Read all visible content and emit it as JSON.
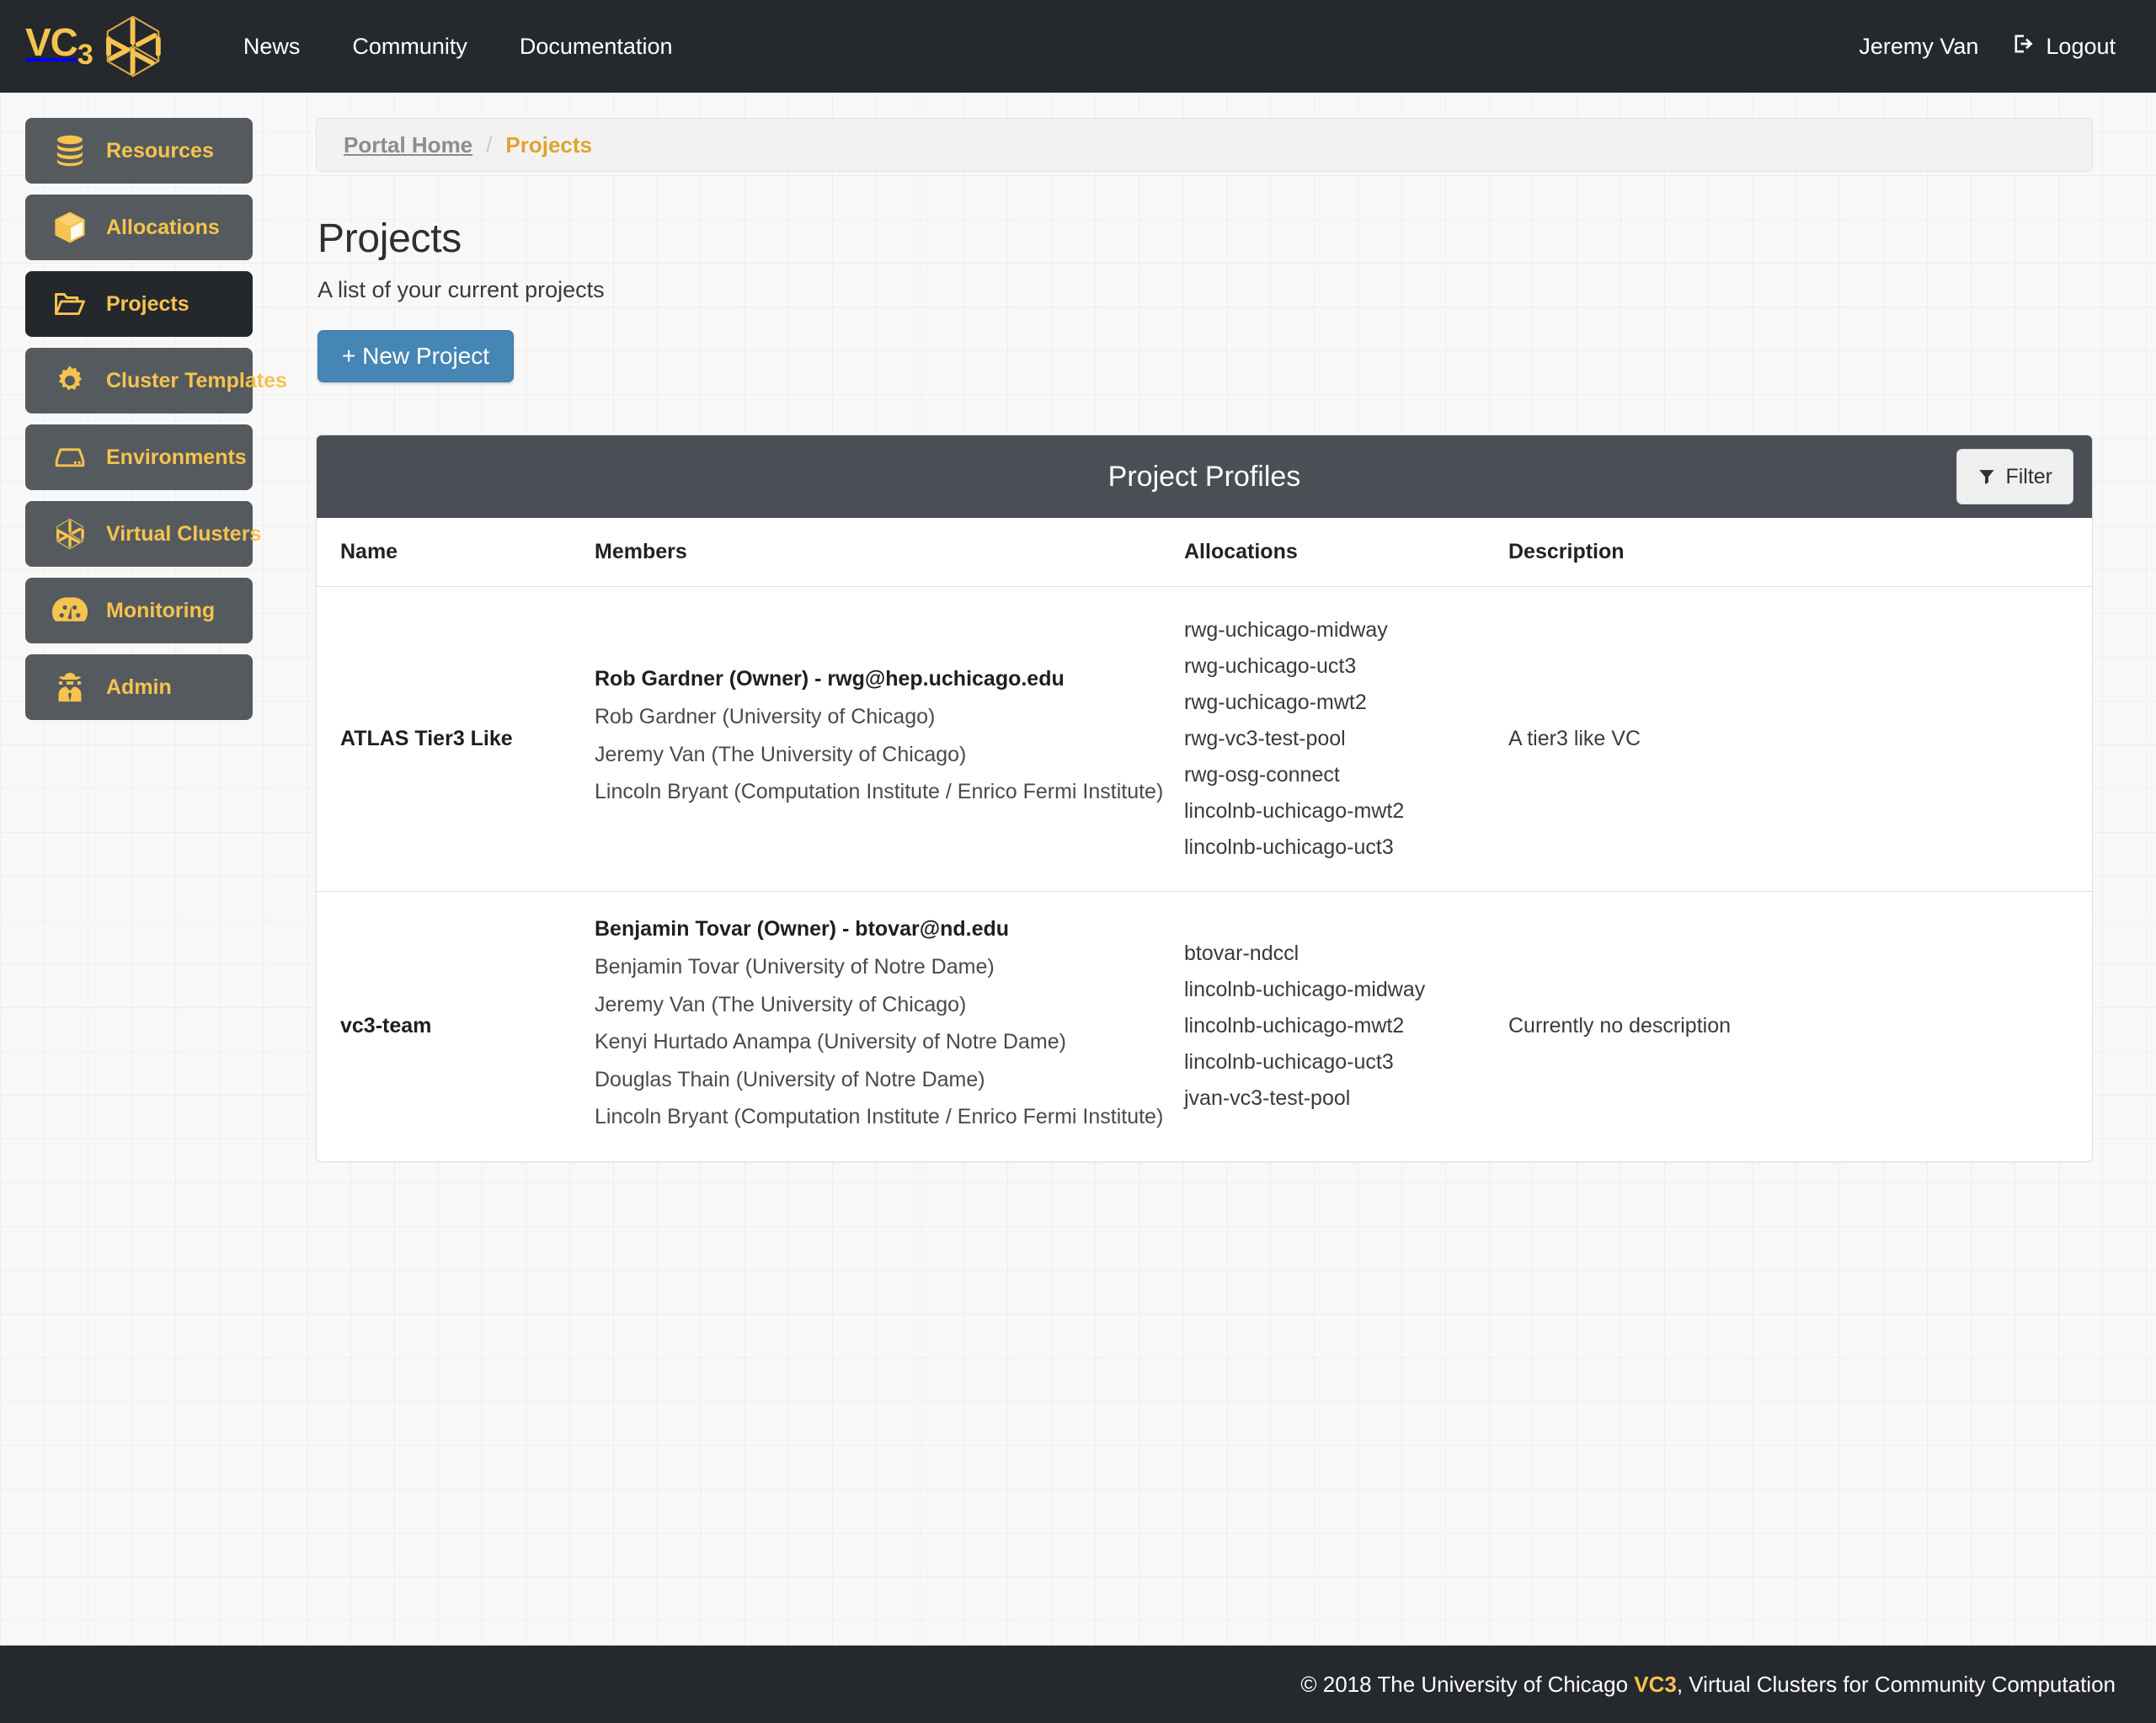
{
  "brand": {
    "text": "VC3",
    "logo_icon": "vc3-hexagon-cube-logo"
  },
  "topnav": {
    "links": [
      {
        "label": "News"
      },
      {
        "label": "Community"
      },
      {
        "label": "Documentation"
      }
    ],
    "user_name": "Jeremy Van",
    "logout_label": "Logout",
    "logout_icon": "sign-out-icon"
  },
  "sidebar": {
    "items": [
      {
        "label": "Resources",
        "icon": "database-icon",
        "active": false
      },
      {
        "label": "Allocations",
        "icon": "cube-icon",
        "active": false
      },
      {
        "label": "Projects",
        "icon": "folder-open-icon",
        "active": true
      },
      {
        "label": "Cluster Templates",
        "icon": "gear-icon",
        "active": false
      },
      {
        "label": "Environments",
        "icon": "hard-drive-icon",
        "active": false
      },
      {
        "label": "Virtual Clusters",
        "icon": "hexagon-cube-icon",
        "active": false
      },
      {
        "label": "Monitoring",
        "icon": "gauge-icon",
        "active": false
      },
      {
        "label": "Admin",
        "icon": "user-secret-icon",
        "active": false
      }
    ]
  },
  "breadcrumb": {
    "home": "Portal Home",
    "separator": "/",
    "current": "Projects"
  },
  "page": {
    "title": "Projects",
    "subtitle": "A list of your current projects",
    "new_project_label": "+ New Project"
  },
  "panel": {
    "title": "Project Profiles",
    "filter_label": "Filter",
    "filter_icon": "filter-icon",
    "columns": [
      "Name",
      "Members",
      "Allocations",
      "Description"
    ],
    "rows": [
      {
        "name": "ATLAS Tier3 Like",
        "owner": "Rob Gardner (Owner) - rwg@hep.uchicago.edu",
        "members": [
          "Rob Gardner (University of Chicago)",
          "Jeremy Van (The University of Chicago)",
          "Lincoln Bryant (Computation Institute / Enrico Fermi Institute)"
        ],
        "allocations": [
          "rwg-uchicago-midway",
          "rwg-uchicago-uct3",
          "rwg-uchicago-mwt2",
          "rwg-vc3-test-pool",
          "rwg-osg-connect",
          "lincolnb-uchicago-mwt2",
          "lincolnb-uchicago-uct3"
        ],
        "description": "A tier3 like VC"
      },
      {
        "name": "vc3-team",
        "owner": "Benjamin Tovar (Owner) - btovar@nd.edu",
        "members": [
          "Benjamin Tovar (University of Notre Dame)",
          "Jeremy Van (The University of Chicago)",
          "Kenyi Hurtado Anampa (University of Notre Dame)",
          "Douglas Thain (University of Notre Dame)",
          "Lincoln Bryant (Computation Institute / Enrico Fermi Institute)"
        ],
        "allocations": [
          "btovar-ndccl",
          "lincolnb-uchicago-midway",
          "lincolnb-uchicago-mwt2",
          "lincolnb-uchicago-uct3",
          "jvan-vc3-test-pool"
        ],
        "description": "Currently no description"
      }
    ]
  },
  "footer": {
    "prefix": "© 2018 The University of Chicago ",
    "brand": "VC3",
    "suffix": ", Virtual Clusters for Community Computation"
  },
  "colors": {
    "brand_yellow": "#f6c34f",
    "nav_dark": "#25282c",
    "sidebar_grey": "#555a5e",
    "sidebar_active": "#24272b",
    "panel_head": "#4a4f55",
    "primary_button": "#4586b4"
  }
}
